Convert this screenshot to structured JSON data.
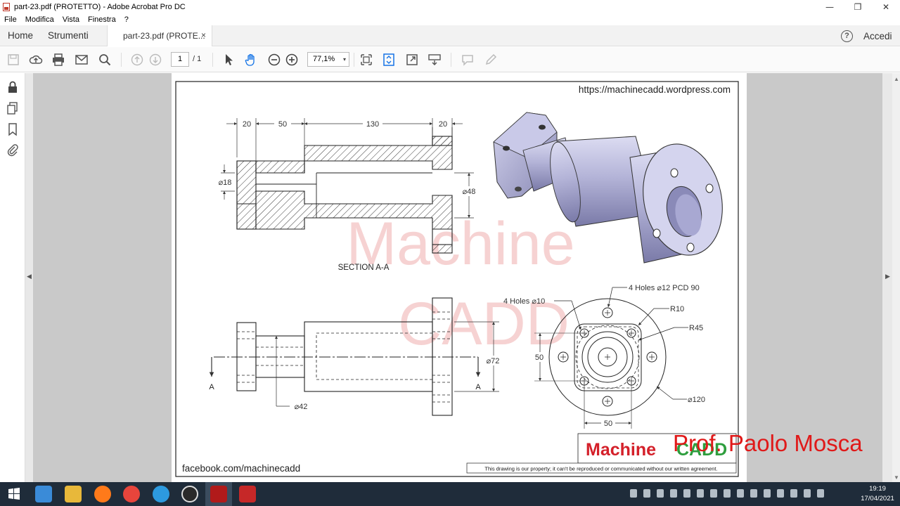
{
  "window": {
    "title": "part-23.pdf (PROTETTO) - Adobe Acrobat Pro DC",
    "min": "—",
    "restore": "❐",
    "close": "✕"
  },
  "menu": [
    "File",
    "Modifica",
    "Vista",
    "Finestra",
    "?"
  ],
  "tabs": {
    "home": "Home",
    "tools": "Strumenti",
    "document": "part-23.pdf (PROTE...",
    "close": "×",
    "help": "?",
    "login": "Accedi"
  },
  "toolbar": {
    "page_current": "1",
    "page_total": "/ 1",
    "zoom": "77,1%",
    "zoom_caret": "▾"
  },
  "sidebar": {
    "icons": [
      "lock-icon",
      "pages-icon",
      "bookmark-icon",
      "paperclip-icon"
    ],
    "left_arrow": "◀",
    "right_arrow": "▶"
  },
  "drawing": {
    "url": "https://machinecadd.wordpress.com",
    "watermark_1": "Machine",
    "watermark_2": "CADD",
    "section_label": "SECTION A-A",
    "dims_top": [
      "20",
      "50",
      "130",
      "20"
    ],
    "dia_18": "⌀18",
    "dia_48": "⌀48",
    "dia_72": "⌀72",
    "dia_42": "⌀42",
    "dia_120": "⌀120",
    "holes_12": "4 Holes ⌀12 PCD 90",
    "holes_10": "4 Holes ⌀10",
    "r10": "R10",
    "r45": "R45",
    "dim_50_v": "50",
    "dim_50_h": "50",
    "section_a": "A",
    "footer_left": "facebook.com/machinecadd",
    "footer_notice": "This drawing is our property; it can't be reproduced or communicated without our written agreement.",
    "logo_machine": "Machine",
    "logo_cadd": "CADD",
    "overlay_text": "Prof. Paolo Mosca"
  },
  "clock": {
    "time": "19:19",
    "date": "17/04/2021"
  },
  "colors": {
    "logo_red": "#d4202a",
    "logo_green": "#2e9e3e",
    "overlay_red": "#e01919",
    "watermark": "#f6d2d2",
    "taskbar": "#1f2c3a",
    "accent_blue": "#1473e6"
  }
}
